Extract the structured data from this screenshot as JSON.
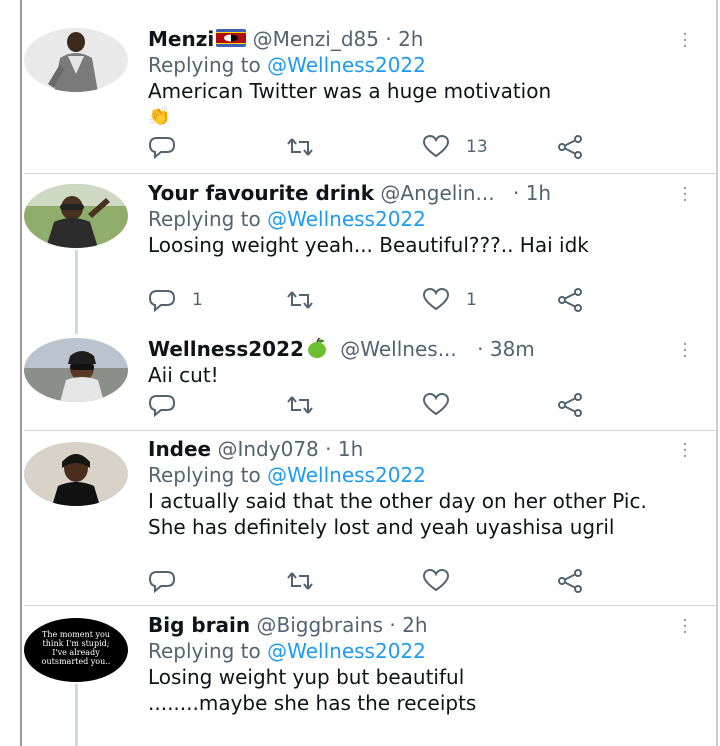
{
  "tweets": [
    {
      "name": "Menzi",
      "handle": "@Menzi_d85",
      "time": "· 2h",
      "replying_prefix": "Replying to ",
      "replying_handle": "@Wellness2022",
      "text": "American Twitter was a huge motivation",
      "emoji_line": "👏",
      "replies": "",
      "retweets": "",
      "likes": "13"
    },
    {
      "name": "Your favourite drink",
      "handle": "@Angelin...",
      "time": "· 1h",
      "replying_prefix": "Replying to ",
      "replying_handle": "@Wellness2022",
      "text": "Loosing weight yeah... Beautiful???.. Hai idk",
      "replies": "1",
      "retweets": "",
      "likes": "1"
    },
    {
      "name": "Wellness2022",
      "handle": "@Wellnes...",
      "time": "· 38m",
      "text": "Aii cut!",
      "replies": "",
      "retweets": "",
      "likes": ""
    },
    {
      "name": "Indee",
      "handle": "@Indy078",
      "time": "· 1h",
      "replying_prefix": "Replying to ",
      "replying_handle": "@Wellness2022",
      "text": "I actually said that the other day on her other Pic. She has definitely lost and yeah uyashisa ugril",
      "replies": "",
      "retweets": "",
      "likes": ""
    },
    {
      "name": "Big brain",
      "handle": "@Biggbrains",
      "time": "· 2h",
      "replying_prefix": "Replying to ",
      "replying_handle": "@Wellness2022",
      "text": "Losing weight yup but beautiful ........maybe she has the receipts",
      "avatar_text": "The moment you think I'm stupid; I've already outsmarted you.."
    }
  ],
  "icons": {
    "reply": "reply-icon",
    "retweet": "retweet-icon",
    "like": "heart-icon",
    "share": "share-icon",
    "more": "more-dots-icon"
  },
  "colors": {
    "link": "#1d9bf0",
    "secondary_text": "#536471",
    "primary_text": "#0f1419"
  }
}
